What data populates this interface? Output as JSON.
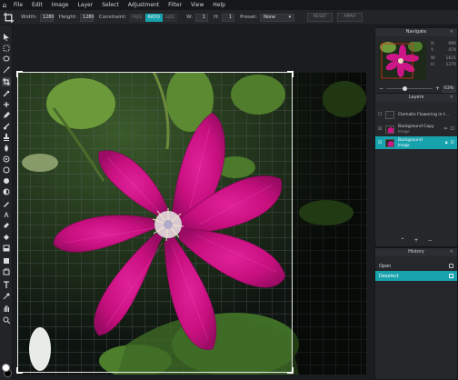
{
  "menubar": {
    "items": [
      "File",
      "Edit",
      "Image",
      "Layer",
      "Select",
      "Adjustment",
      "Filter",
      "View",
      "Help"
    ]
  },
  "options": {
    "width_label": "Width:",
    "width_value": "1280",
    "height_label": "Height:",
    "height_value": "1280",
    "constraint_label": "Constraint:",
    "constraint_options": [
      "FREE",
      "RATIO",
      "SIZE"
    ],
    "constraint_selected": "RATIO",
    "w_label": "W:",
    "w_value": "1",
    "h_label": "H:",
    "h_value": "1",
    "preset_label": "Preset:",
    "preset_value": "None",
    "reset_label": "RESET",
    "apply_label": "APPLY"
  },
  "navigator": {
    "title": "Navigate",
    "x_label": "X:",
    "x_value": "990",
    "y_label": "Y:",
    "y_value": "474",
    "w_label": "W:",
    "w_value": "1621",
    "h_label": "H:",
    "h_value": "1270",
    "zoom": "63%",
    "zoom_level": 0.4
  },
  "layers": {
    "title": "Layers",
    "rows": [
      {
        "name": "Clematis Flowering in t...",
        "sub": "",
        "selected": false
      },
      {
        "name": "Background Copy",
        "sub": "Image",
        "selected": false
      },
      {
        "name": "Background",
        "sub": "Image",
        "selected": true
      }
    ]
  },
  "history": {
    "title": "History",
    "rows": [
      {
        "label": "Open",
        "selected": false
      },
      {
        "label": "Deselect",
        "selected": true
      }
    ]
  },
  "colors": {
    "accent": "#17a2ad",
    "foreground": "#ffffff",
    "background": "#000000"
  }
}
